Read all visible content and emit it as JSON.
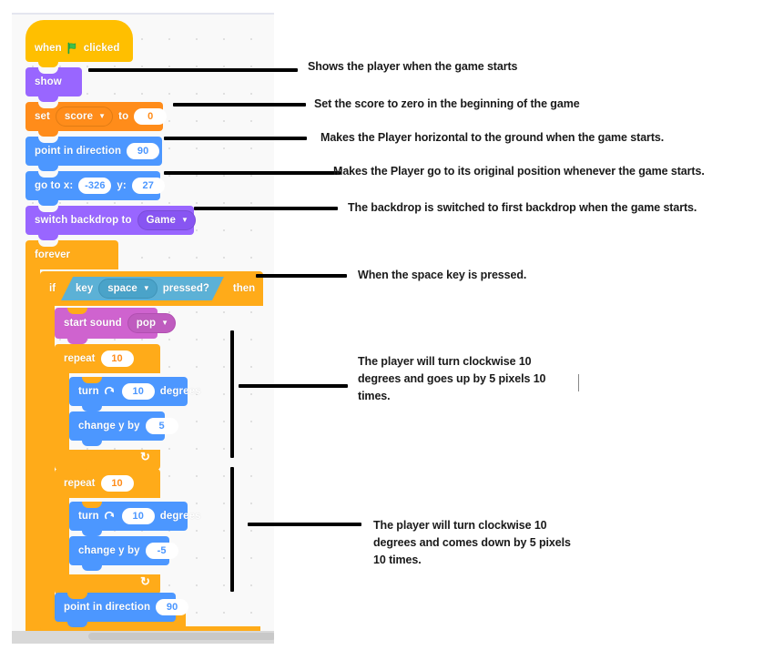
{
  "app": "Scratch script editor annotation",
  "canvas": {
    "scrollbar": "horizontal-scrollbar"
  },
  "script": {
    "blocks": [
      {
        "id": "when-flag-clicked",
        "category": "events",
        "words": [
          "when",
          "clicked"
        ],
        "icon": "green-flag-icon"
      },
      {
        "id": "show",
        "category": "looks",
        "label": "show"
      },
      {
        "id": "set-variable",
        "category": "variables",
        "label_a": "set",
        "dropdown": "score",
        "label_b": "to",
        "value": "0"
      },
      {
        "id": "point-in-direction",
        "category": "motion",
        "label": "point in direction",
        "value": "90"
      },
      {
        "id": "go-to-xy",
        "category": "motion",
        "label_x": "go to x:",
        "x": "-326",
        "label_y": "y:",
        "y": "27"
      },
      {
        "id": "switch-backdrop",
        "category": "looks",
        "label": "switch backdrop to",
        "dropdown": "Game"
      },
      {
        "id": "forever",
        "category": "control",
        "label": "forever"
      },
      {
        "id": "if-then",
        "category": "control",
        "label_if": "if",
        "label_then": "then",
        "condition": {
          "label_a": "key",
          "dropdown": "space",
          "label_b": "pressed?"
        }
      },
      {
        "id": "start-sound",
        "category": "sound",
        "label": "start sound",
        "dropdown": "pop"
      },
      {
        "id": "repeat-1",
        "category": "control",
        "label": "repeat",
        "value": "10"
      },
      {
        "id": "turn-cw-1",
        "category": "motion",
        "label_a": "turn",
        "icon": "turn-clockwise-icon",
        "value": "10",
        "label_b": "degrees"
      },
      {
        "id": "change-y-1",
        "category": "motion",
        "label": "change y by",
        "value": "5"
      },
      {
        "id": "repeat-2",
        "category": "control",
        "label": "repeat",
        "value": "10"
      },
      {
        "id": "turn-cw-2",
        "category": "motion",
        "label_a": "turn",
        "icon": "turn-clockwise-icon",
        "value": "10",
        "label_b": "degrees"
      },
      {
        "id": "change-y-2",
        "category": "motion",
        "label": "change y by",
        "value": "-5"
      },
      {
        "id": "point-in-direction-2",
        "category": "motion",
        "label": "point in direction",
        "value": "90"
      }
    ]
  },
  "annotations": [
    {
      "id": "ann-show",
      "text": "Shows the player when the game starts"
    },
    {
      "id": "ann-set-score",
      "text": "Set the score to zero in the beginning of the game"
    },
    {
      "id": "ann-point-direction",
      "text": "Makes the Player horizontal to the ground when the game starts."
    },
    {
      "id": "ann-go-to-xy",
      "text": "Makes the Player go to its original position whenever the game starts."
    },
    {
      "id": "ann-switch-backdrop",
      "text": "The backdrop is switched to first backdrop when the game starts."
    },
    {
      "id": "ann-if-space",
      "text": "When the space key is pressed."
    },
    {
      "id": "ann-repeat-up",
      "line1": "The player will turn clockwise 10",
      "line2": "degrees and goes up by 5 pixels 10",
      "line3": "times."
    },
    {
      "id": "ann-repeat-down",
      "line1": "The player will turn clockwise 10",
      "line2": "degrees and comes down by 5 pixels",
      "line3": "10 times."
    }
  ],
  "colors": {
    "events": "#ffbf00",
    "looks": "#9966ff",
    "variables": "#ff8c1a",
    "motion": "#4c97ff",
    "control": "#ffab19",
    "sound": "#cf63cf",
    "sensing": "#5cb1d6",
    "annotation_text": "#1a1a1a",
    "canvas_background": "#f9f9f9"
  }
}
